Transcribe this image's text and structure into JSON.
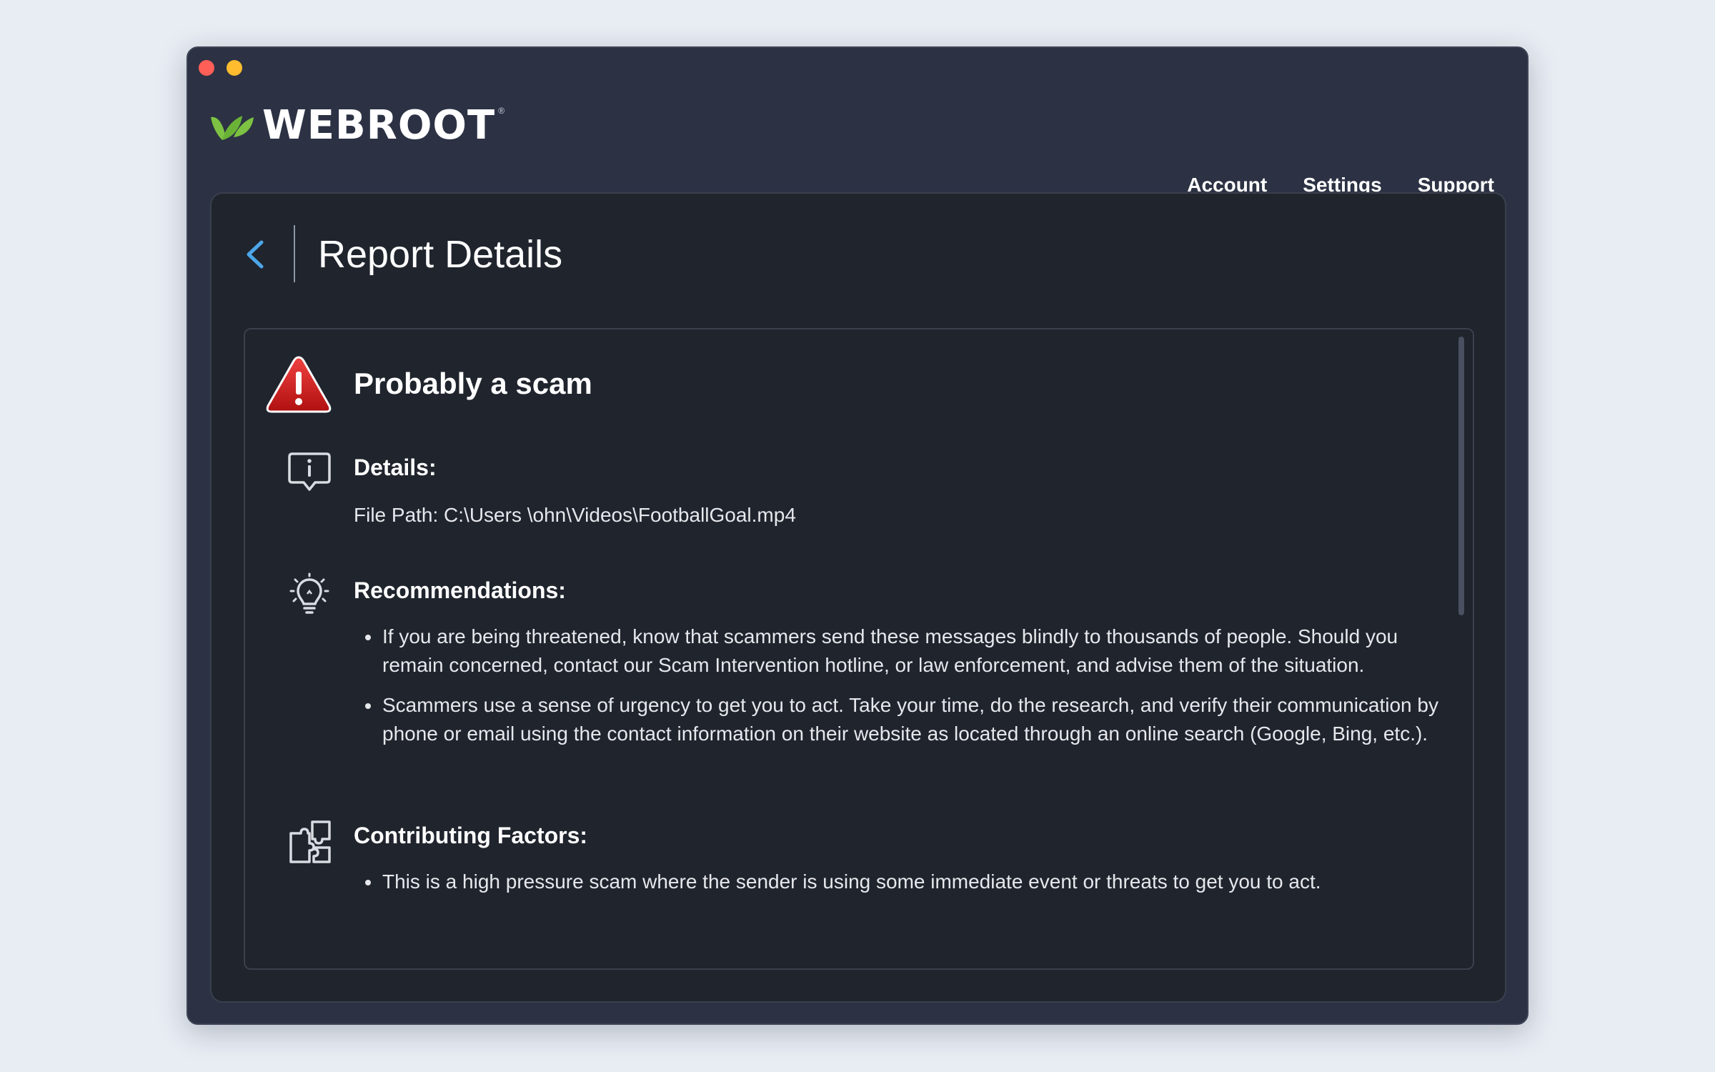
{
  "app": {
    "brand": "WEBROOT",
    "brand_reg": "®",
    "brand_color": "#7dc242",
    "accent_color": "#4da6e8"
  },
  "nav": {
    "items": [
      {
        "label": "Account"
      },
      {
        "label": "Settings"
      },
      {
        "label": "Support"
      }
    ]
  },
  "header": {
    "title": "Report Details"
  },
  "report": {
    "verdict": "Probably a scam",
    "verdict_icon": "warning-triangle-icon",
    "details": {
      "title": "Details:",
      "icon": "info-chat-icon",
      "text": "File Path: C:\\Users \\ohn\\Videos\\FootballGoal.mp4"
    },
    "recommendations": {
      "title": "Recommendations:",
      "icon": "lightbulb-icon",
      "items": [
        "If you are being threatened, know that scammers send these messages blindly to thousands of people. Should you remain concerned, contact our Scam Intervention hotline, or law enforcement, and advise them of the situation.",
        "Scammers use a sense of urgency to get you to act. Take your time, do the research, and verify their communication by phone or email using the contact information on their website as located through an online search (Google, Bing, etc.)."
      ]
    },
    "factors": {
      "title": "Contributing Factors:",
      "icon": "puzzle-icon",
      "items": [
        "This is a high pressure scam where the sender is using some immediate event or threats to get you to act."
      ]
    }
  }
}
